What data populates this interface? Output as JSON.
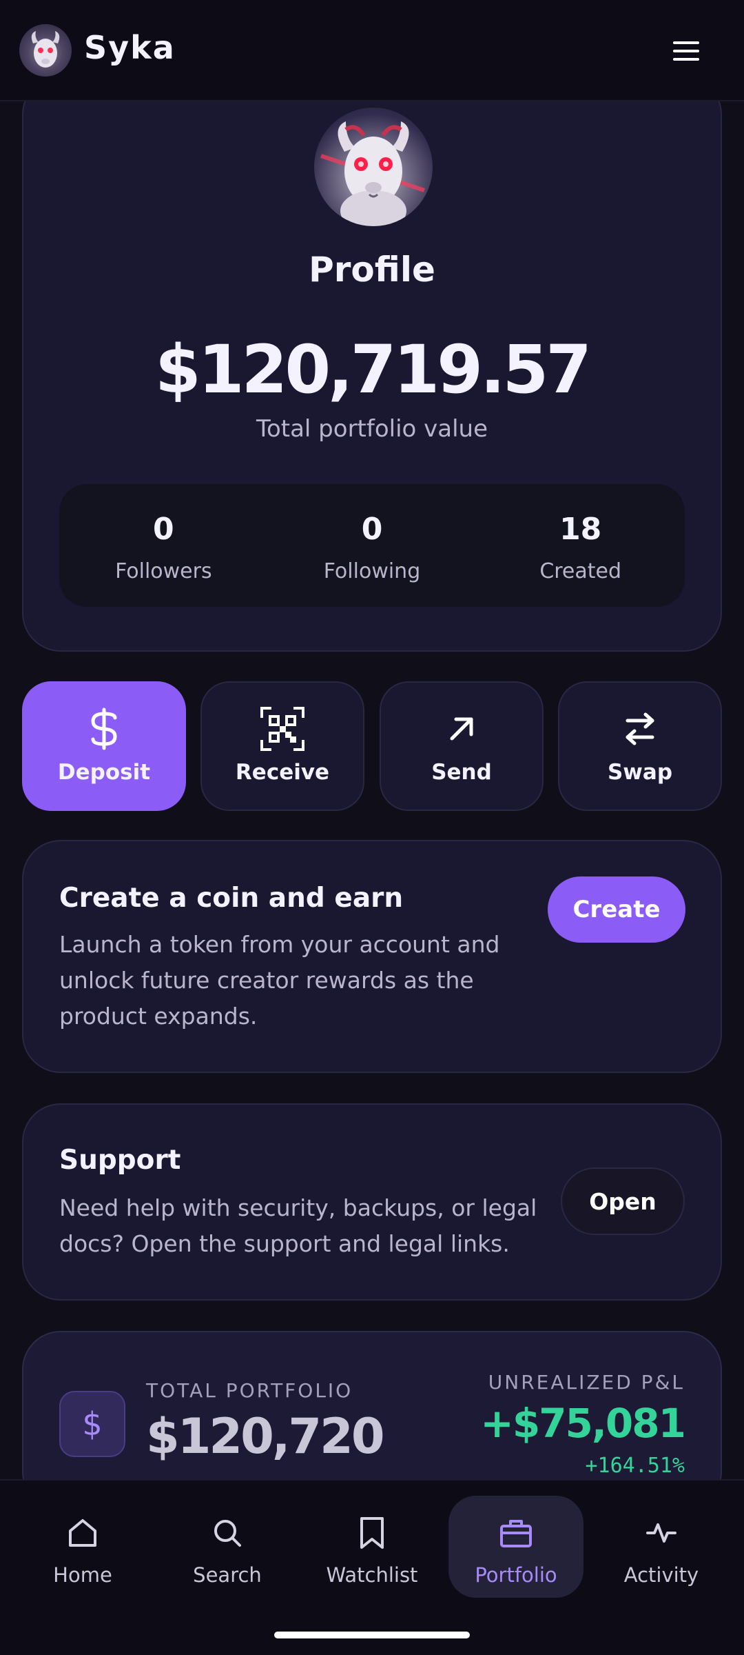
{
  "header": {
    "brand": "Syka"
  },
  "profile": {
    "title": "Profile",
    "total_value": "$120,719.57",
    "total_value_label": "Total portfolio value",
    "stats": [
      {
        "value": "0",
        "label": "Followers"
      },
      {
        "value": "0",
        "label": "Following"
      },
      {
        "value": "18",
        "label": "Created"
      }
    ]
  },
  "actions": [
    {
      "label": "Deposit",
      "icon": "dollar-icon"
    },
    {
      "label": "Receive",
      "icon": "qr-code-icon"
    },
    {
      "label": "Send",
      "icon": "arrow-up-right-icon"
    },
    {
      "label": "Swap",
      "icon": "swap-arrows-icon"
    }
  ],
  "create_card": {
    "title": "Create a coin and earn",
    "desc": "Launch a token from your account and unlock future creator rewards as the product expands.",
    "button": "Create"
  },
  "support_card": {
    "title": "Support",
    "desc": "Need help with security, backups, or legal docs? Open the support and legal links.",
    "button": "Open"
  },
  "portfolio_summary": {
    "label": "TOTAL PORTFOLIO",
    "value": "$120,720",
    "pnl_label": "UNREALIZED P&L",
    "pnl_value": "+$75,081",
    "pnl_pct": "+164.51%",
    "icon_glyph": "$"
  },
  "nav": [
    {
      "label": "Home",
      "icon": "home-icon",
      "active": false
    },
    {
      "label": "Search",
      "icon": "search-icon",
      "active": false
    },
    {
      "label": "Watchlist",
      "icon": "bookmark-icon",
      "active": false
    },
    {
      "label": "Portfolio",
      "icon": "briefcase-icon",
      "active": true
    },
    {
      "label": "Activity",
      "icon": "activity-icon",
      "active": false
    }
  ],
  "colors": {
    "accent": "#8b5cf6",
    "accent_light": "#a78bfa",
    "positive": "#34d399",
    "background": "#0f0e19",
    "card": "#1a1830"
  }
}
